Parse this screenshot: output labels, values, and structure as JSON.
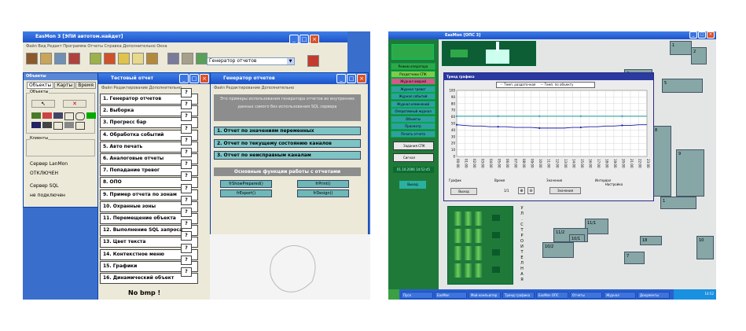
{
  "left": {
    "main_title": "EasMon 3 [ЭПИ автотом.найдет]",
    "main_menu": "Файл Вид Редакт Программа Отчеты Справка Дополнительно Окна",
    "dropdown_value": "Генератор отчетов",
    "panel_title": "Объекты",
    "panel_tabs": [
      "Объекты",
      "Карты",
      "Время"
    ],
    "panel_group": "Объекты",
    "panel_group2": "Клиенты",
    "server_label": "Сервер LanMon",
    "server_status": "ОТКЛЮЧЕН",
    "sql_label": "Сервер SQL",
    "sql_status": "не подключен",
    "report_list_title": "Тестовый отчет",
    "report_list_menu": "Файл Редактирование Дополнительно",
    "report_items": [
      "1. Генератор отчетов",
      "2. Выборка",
      "3. Прогресс бар",
      "4. Обработка событий",
      "5. Авто печать",
      "6. Аналоговые отчеты",
      "7. Попадание тревог",
      "8. ОПО",
      "9. Пример отчета по зонам",
      "10. Охранные зоны",
      "11. Перемещение объекта",
      "12. Выполнение SQL запроса",
      "13. Цвет текста",
      "14. Контекстное меню",
      "15. Графики",
      "16. Динамический объект"
    ],
    "qmark": "?",
    "no_bmp": "No bmp !",
    "gen_title": "Генератор отчетов",
    "gen_menu": "Файл Редактирование Дополнительно",
    "gen_info": "Это примеры использования генератора отчетов во внутренних данных самого без использования SQL сервера",
    "gen_options": [
      "1. Отчет по значениям переменных",
      "2. Отчет по текущему состоянию каналов",
      "3. Отчет по неисправным каналам"
    ],
    "gen_functions_title": "Основные функции работы с отчетами",
    "gen_buttons": [
      "frShowPrepared()",
      "frPrint()",
      "frExport()",
      "frDesign()"
    ]
  },
  "right": {
    "main_title": "EasMon [ОПС 3]",
    "chart_window_title": "Тренд графика",
    "legend": [
      "Темп. раздаточная",
      "Темп. по объекту"
    ],
    "side_buttons": [
      "Режим оператора",
      "Раздатчики СПК",
      "Журнал аварий",
      "Журнал тревог",
      "Журнал событий",
      "Журнал изменений",
      "Оперативный журнал",
      "Объекты",
      "Просмотр",
      "Печать отчета"
    ],
    "chart_footer_labels": [
      "График",
      "Время",
      "Значения",
      "Интервал"
    ],
    "chart_controls": [
      "Выход",
      "1/1",
      "Значения",
      "Настройка"
    ],
    "mini_buttons": [
      "Задания СПК",
      "Сигнал"
    ],
    "timestamp": "01.10.2006 14:52:45",
    "small_btn": "Выход",
    "street_letters": [
      "У",
      "Л",
      ".",
      "С",
      "Т",
      "Р",
      "О",
      "И",
      "Т",
      "Е",
      "Л",
      "Н",
      "А",
      "Я"
    ],
    "building_labels": [
      "1",
      "18",
      "4",
      "5",
      "2",
      "1",
      "11/1",
      "11/2",
      "10/2",
      "10/1",
      "8",
      "9",
      "10",
      "7"
    ],
    "taskbar_items": [
      "Пуск",
      "EasMon",
      "Мой компьютер",
      "Тренд графика",
      "EasMon ОПС",
      "Отчеты",
      "Журнал",
      "Документы"
    ],
    "tray_time": "14:52"
  },
  "chart_data": {
    "type": "line",
    "title": "",
    "xlabel": "",
    "ylabel": "",
    "ylim": [
      0,
      100
    ],
    "y_ticks": [
      0,
      10,
      20,
      30,
      40,
      50,
      60,
      70,
      80,
      90,
      100
    ],
    "x": [
      "00:00",
      "01:00",
      "02:00",
      "03:00",
      "04:00",
      "05:00",
      "06:00",
      "07:00",
      "08:00",
      "09:00",
      "10:00",
      "11:00",
      "12:00",
      "13:00",
      "14:00",
      "15:00",
      "16:00",
      "17:00",
      "18:00",
      "19:00",
      "20:00",
      "21:00",
      "22:00",
      "23:00"
    ],
    "series": [
      {
        "name": "Темп. раздаточная",
        "color": "#2aa8a8",
        "values": [
          61,
          61,
          61,
          61,
          61,
          61,
          61,
          61,
          61,
          61,
          61,
          61,
          61,
          61,
          61,
          61,
          61,
          61,
          61,
          61,
          61,
          61,
          61,
          61
        ]
      },
      {
        "name": "Темп. по объекту",
        "color": "#1a1aa0",
        "values": [
          48,
          47,
          46,
          46,
          45,
          45,
          45,
          44,
          44,
          44,
          43,
          43,
          43,
          43,
          44,
          44,
          45,
          45,
          46,
          46,
          47,
          47,
          48,
          48
        ]
      }
    ],
    "grid": true
  },
  "colors": {
    "xp_blue": "#1c52c9",
    "teal": "#7fc4c4",
    "green": "#2f8f3a",
    "map_bg": "#e4e6e6",
    "building": "#87a6a6"
  }
}
